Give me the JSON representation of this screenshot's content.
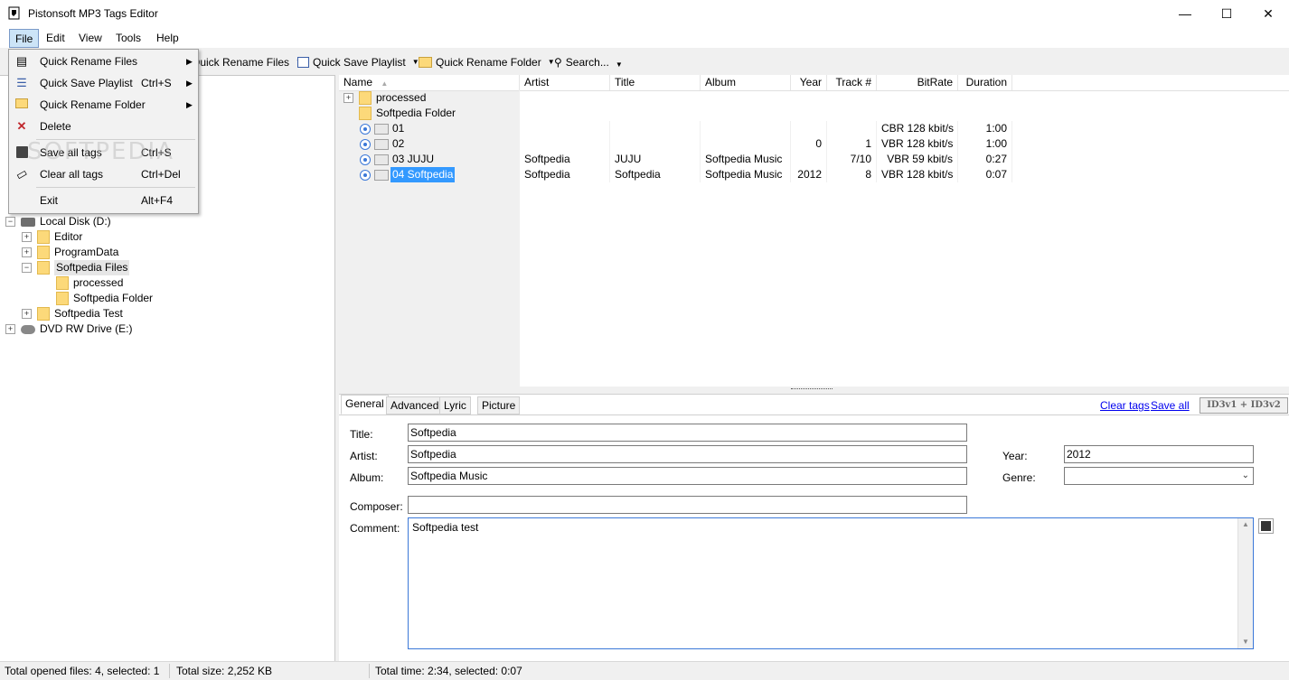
{
  "window": {
    "title": "Pistonsoft MP3 Tags Editor",
    "minimize": "—",
    "maximize": "☐",
    "close": "✕"
  },
  "menubar": {
    "items": [
      "File",
      "Edit",
      "View",
      "Tools",
      "Help"
    ]
  },
  "toolbar": {
    "quick_rename_files": "Quick Rename Files",
    "quick_save_playlist": "Quick Save Playlist",
    "quick_rename_folder": "Quick Rename Folder",
    "search": "Search..."
  },
  "file_menu": {
    "items": [
      {
        "label": "Quick Rename Files",
        "shortcut": "",
        "submenu": "▶"
      },
      {
        "label": "Quick Save Playlist",
        "shortcut": "Ctrl+S",
        "submenu": "▶"
      },
      {
        "label": "Quick Rename Folder",
        "shortcut": "",
        "submenu": "▶"
      },
      {
        "label": "Delete",
        "shortcut": "",
        "submenu": ""
      },
      {
        "label": "Save all tags",
        "shortcut": "Ctrl+S",
        "submenu": ""
      },
      {
        "label": "Clear all tags",
        "shortcut": "Ctrl+Del",
        "submenu": ""
      },
      {
        "label": "Exit",
        "shortcut": "Alt+F4",
        "submenu": ""
      }
    ]
  },
  "watermark": "SOFTPEDIA",
  "tree": {
    "nodes": [
      {
        "label": "Local Disk (D:)",
        "type": "drive"
      },
      {
        "label": "Editor",
        "type": "folder"
      },
      {
        "label": "ProgramData",
        "type": "folder"
      },
      {
        "label": "Softpedia Files",
        "type": "folder"
      },
      {
        "label": "processed",
        "type": "folder"
      },
      {
        "label": "Softpedia Folder",
        "type": "folder"
      },
      {
        "label": "Softpedia Test",
        "type": "folder"
      },
      {
        "label": "DVD RW Drive (E:)",
        "type": "drive"
      }
    ]
  },
  "file_list": {
    "columns": [
      "Name",
      "Artist",
      "Title",
      "Album",
      "Year",
      "Track #",
      "BitRate",
      "Duration"
    ],
    "sort_indicator": "▲",
    "folders": [
      "processed",
      "Softpedia Folder"
    ],
    "rows": [
      {
        "name": "01",
        "artist": "",
        "title": "",
        "album": "",
        "year": "",
        "track": "",
        "bitrate": "CBR 128 kbit/s",
        "duration": "1:00"
      },
      {
        "name": "02",
        "artist": "",
        "title": "",
        "album": "",
        "year": "0",
        "track": "1",
        "bitrate": "VBR 128 kbit/s",
        "duration": "1:00"
      },
      {
        "name": "03 JUJU",
        "artist": "Softpedia",
        "title": "JUJU",
        "album": "Softpedia Music",
        "year": "",
        "track": "7/10",
        "bitrate": "VBR 59 kbit/s",
        "duration": "0:27"
      },
      {
        "name": "04 Softpedia",
        "artist": "Softpedia",
        "title": "Softpedia",
        "album": "Softpedia Music",
        "year": "2012",
        "track": "8",
        "bitrate": "VBR 128 kbit/s",
        "duration": "0:07"
      }
    ]
  },
  "editor": {
    "tabs": [
      "General",
      "Advanced",
      "Lyric",
      "Picture"
    ],
    "clear_tags": "Clear tags",
    "save_all": "Save all",
    "tag_version": "ID3v1 + ID3v2",
    "labels": {
      "title": "Title:",
      "artist": "Artist:",
      "album": "Album:",
      "composer": "Composer:",
      "comment": "Comment:",
      "year": "Year:",
      "genre": "Genre:"
    },
    "values": {
      "title": "Softpedia",
      "artist": "Softpedia",
      "album": "Softpedia Music",
      "composer": "",
      "comment": "Softpedia test",
      "year": "2012",
      "genre": ""
    }
  },
  "status": {
    "opened": "Total opened files: 4, selected: 1",
    "size": "Total size: 2,252 KB",
    "time": "Total time: 2:34, selected: 0:07"
  }
}
